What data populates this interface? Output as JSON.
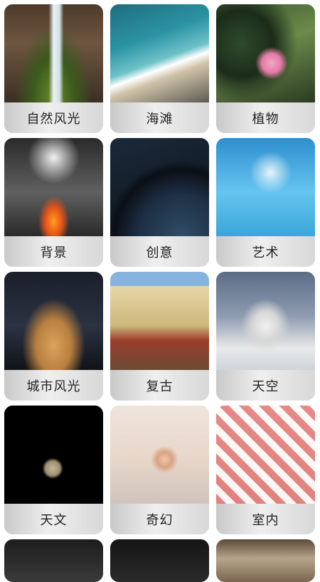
{
  "categories": [
    {
      "label": "自然风光",
      "image": "waterfall-image"
    },
    {
      "label": "海滩",
      "image": "beach-image"
    },
    {
      "label": "植物",
      "image": "flowers-image"
    },
    {
      "label": "背景",
      "image": "splash-image"
    },
    {
      "label": "创意",
      "image": "planet-image"
    },
    {
      "label": "艺术",
      "image": "palm-sky-image"
    },
    {
      "label": "城市风光",
      "image": "tower-image"
    },
    {
      "label": "复古",
      "image": "vintage-building-image"
    },
    {
      "label": "天空",
      "image": "mosque-sky-image"
    },
    {
      "label": "天文",
      "image": "moon-image"
    },
    {
      "label": "奇幻",
      "image": "girl-drawing-image"
    },
    {
      "label": "室内",
      "image": "tablecloth-image"
    }
  ]
}
